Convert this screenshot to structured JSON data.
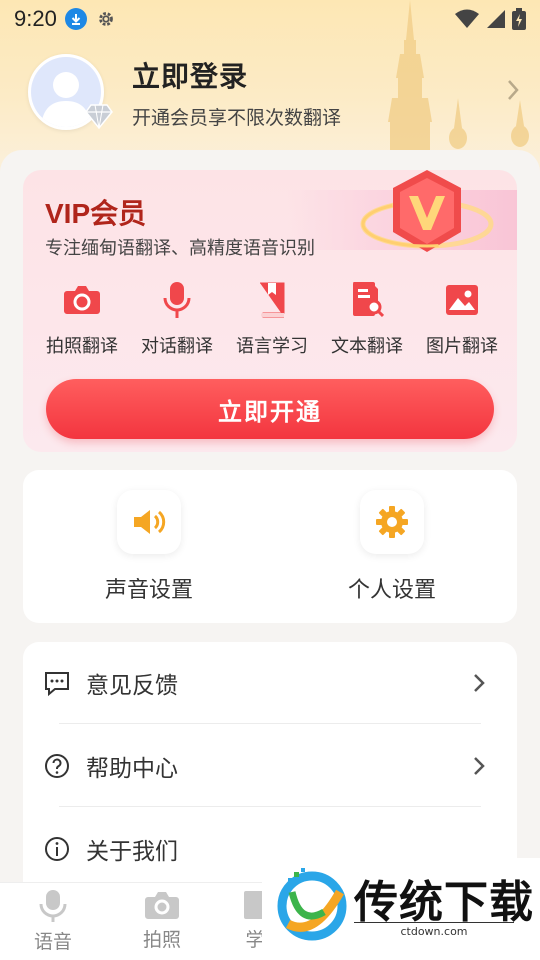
{
  "status_bar": {
    "time": "9:20"
  },
  "profile": {
    "title": "立即登录",
    "subtitle": "开通会员享不限次数翻译"
  },
  "vip": {
    "title": "VIP会员",
    "subtitle": "专注缅甸语翻译、高精度语音识别",
    "features": [
      {
        "label": "拍照翻译",
        "icon": "camera-icon"
      },
      {
        "label": "对话翻译",
        "icon": "microphone-icon"
      },
      {
        "label": "语言学习",
        "icon": "book-icon"
      },
      {
        "label": "文本翻译",
        "icon": "document-search-icon"
      },
      {
        "label": "图片翻译",
        "icon": "image-icon"
      }
    ],
    "button_label": "立即开通",
    "accent_color": "#f3353f"
  },
  "settings": [
    {
      "label": "声音设置",
      "icon": "speaker-icon"
    },
    {
      "label": "个人设置",
      "icon": "gear-icon"
    }
  ],
  "menu": [
    {
      "label": "意见反馈",
      "icon": "feedback-icon"
    },
    {
      "label": "帮助中心",
      "icon": "help-icon"
    },
    {
      "label": "关于我们",
      "icon": "info-icon"
    }
  ],
  "bottom_nav": [
    {
      "label": "语音",
      "icon": "microphone-icon"
    },
    {
      "label": "拍照",
      "icon": "camera-icon"
    },
    {
      "label": "学",
      "icon": "book-icon"
    }
  ],
  "watermark": {
    "text": "传统下载",
    "url": "ctdown.com"
  }
}
